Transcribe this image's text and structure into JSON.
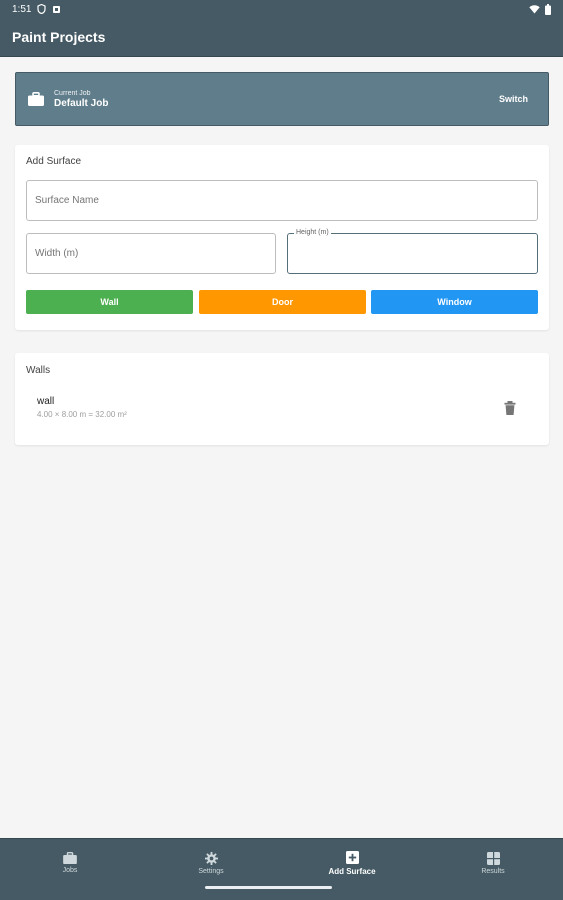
{
  "status_bar": {
    "time": "1:51",
    "icons": [
      "shield-icon",
      "notification-icon",
      "wifi-icon",
      "battery-icon"
    ]
  },
  "app_bar": {
    "title": "Paint Projects"
  },
  "current_job": {
    "caption": "Current Job",
    "name": "Default Job",
    "switch_label": "Switch",
    "icon": "briefcase-icon"
  },
  "add_surface": {
    "title": "Add Surface",
    "surface_name_placeholder": "Surface Name",
    "width_placeholder": "Width (m)",
    "height_label": "Height (m)",
    "buttons": [
      {
        "label": "Wall",
        "color": "#4caf50"
      },
      {
        "label": "Door",
        "color": "#ff9800"
      },
      {
        "label": "Window",
        "color": "#2196f3"
      }
    ]
  },
  "walls": {
    "title": "Walls",
    "items": [
      {
        "name": "wall",
        "dims": "4.00 × 8.00 m = 32.00 m²",
        "action_icon": "trash-icon"
      }
    ]
  },
  "bottom_nav": {
    "items": [
      {
        "label": "Jobs",
        "icon": "briefcase-icon",
        "active": false
      },
      {
        "label": "Settings",
        "icon": "gear-icon",
        "active": false
      },
      {
        "label": "Add Surface",
        "icon": "add-box-icon",
        "active": true
      },
      {
        "label": "Results",
        "icon": "grid-icon",
        "active": false
      }
    ]
  },
  "colors": {
    "primary": "#455a64",
    "job_card": "#607d8b",
    "background": "#f5f5f5",
    "focused_border": "#546e7a"
  }
}
